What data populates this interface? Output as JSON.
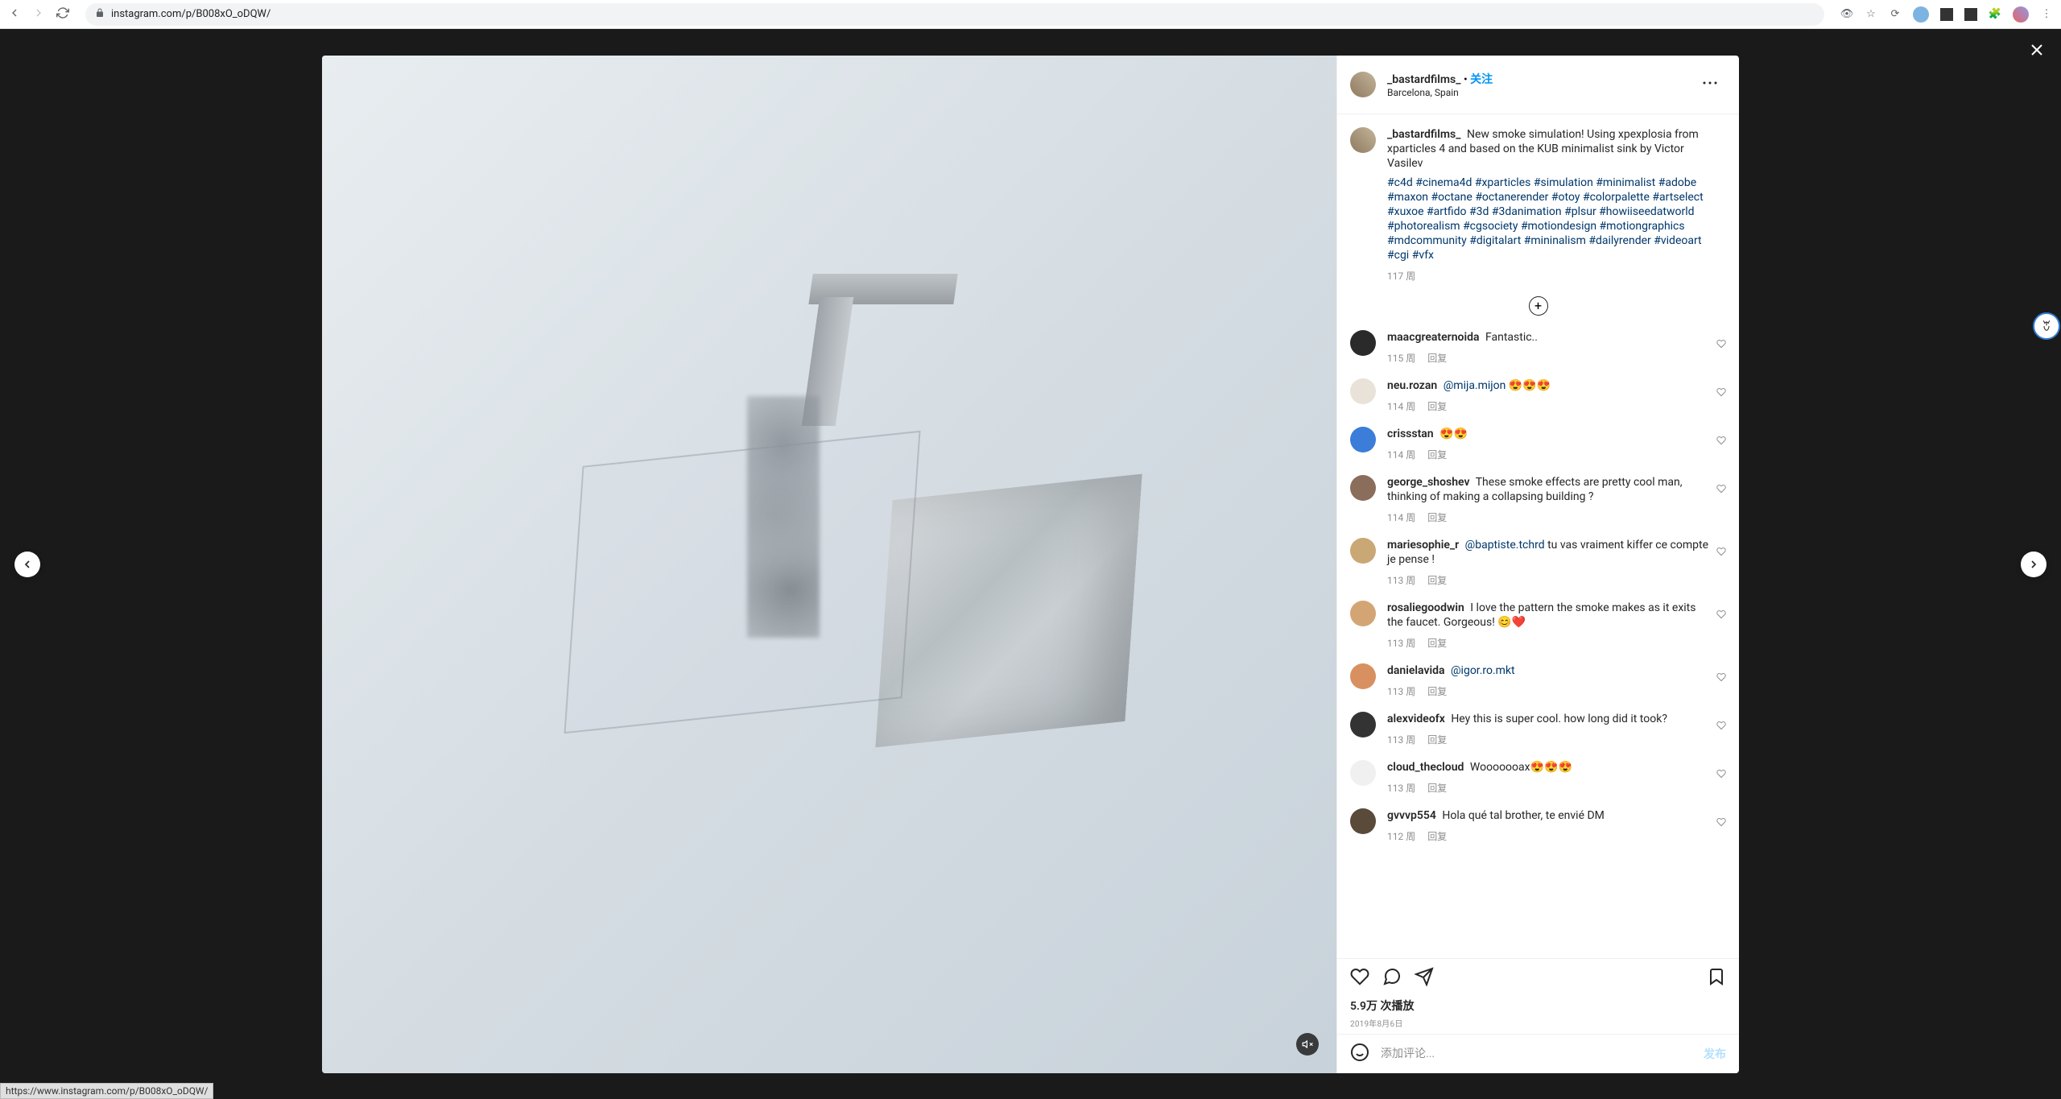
{
  "chrome": {
    "url": "instagram.com/p/B008xO_oDQW/",
    "status_url": "https://www.instagram.com/p/B008xO_oDQW/"
  },
  "post": {
    "author": "_bastardfilms_",
    "follow": "关注",
    "location": "Barcelona, Spain",
    "caption": "New smoke simulation! Using xpexplosia from xparticles 4 and based on the KUB minimalist sink by Victor Vasilev",
    "hashtags": [
      "#c4d",
      "#cinema4d",
      "#xparticles",
      "#simulation",
      "#minimalist",
      "#adobe",
      "#maxon",
      "#octane",
      "#octanerender",
      "#otoy",
      "#colorpalette",
      "#artselect",
      "#xuxoe",
      "#artfido",
      "#3d",
      "#3danimation",
      "#plsur",
      "#howiiseedatworld",
      "#photorealism",
      "#cgsociety",
      "#motiondesign",
      "#motiongraphics",
      "#mdcommunity",
      "#digitalart",
      "#mininalism",
      "#dailyrender",
      "#videoart",
      "#cgi",
      "#vfx"
    ],
    "caption_age": "117 周",
    "play_count": "5.9万 次播放",
    "date": "2019年8月6日",
    "comment_placeholder": "添加评论...",
    "publish": "发布",
    "reply_label": "回复"
  },
  "comments": [
    {
      "user": "maacgreaternoida",
      "text": "Fantastic..",
      "age": "115 周"
    },
    {
      "user": "neu.rozan",
      "mention": "@mija.mijon",
      "text": " 😍😍😍",
      "age": "114 周"
    },
    {
      "user": "crissstan",
      "text": "😍😍",
      "age": "114 周"
    },
    {
      "user": "george_shoshev",
      "text": "These smoke effects are pretty cool man, thinking of making a collapsing building ?",
      "age": "114 周"
    },
    {
      "user": "mariesophie_r",
      "mention": "@baptiste.tchrd",
      "text": " tu vas vraiment kiffer ce compte je pense !",
      "age": "113 周"
    },
    {
      "user": "rosaliegoodwin",
      "text": "I love the pattern the smoke makes as it exits the faucet. Gorgeous! 😊❤️",
      "age": "113 周"
    },
    {
      "user": "danielavida",
      "mention": "@igor.ro.mkt",
      "text": "",
      "age": "113 周"
    },
    {
      "user": "alexvideofx",
      "text": "Hey this is super cool. how long did it took?",
      "age": "113 周"
    },
    {
      "user": "cloud_thecloud",
      "text": "Wooooooax😍😍😍",
      "age": "113 周"
    },
    {
      "user": "gvvvp554",
      "text": "Hola qué tal brother, te envié DM",
      "age": "112 周"
    }
  ]
}
